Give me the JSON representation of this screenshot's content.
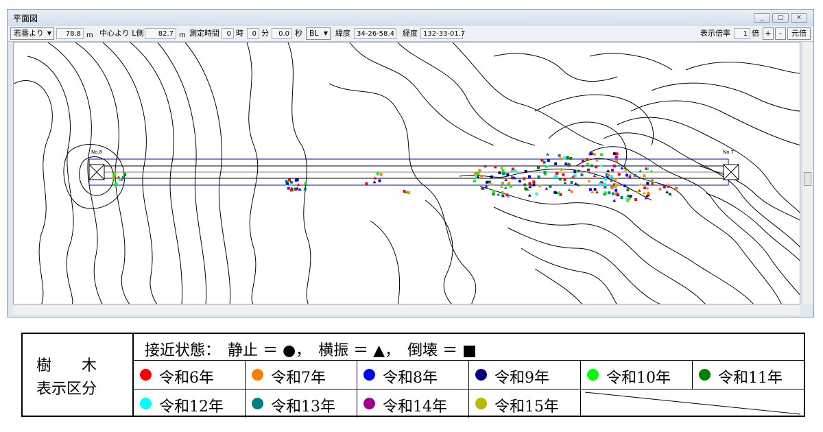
{
  "window": {
    "title": "平面図"
  },
  "toolbar": {
    "from_select": "若番より",
    "distance_value": "78.8",
    "unit_m": "m",
    "center_label": "中心より L側",
    "offset_value": "82.7",
    "measure_time_label": "測定時間",
    "hours": "0",
    "hours_unit": "時",
    "minutes": "0",
    "minutes_unit": "分",
    "seconds": "0.0",
    "seconds_unit": "秒",
    "bl_select": "BL",
    "lat_label": "緯度",
    "lat_value": "34-26-58.4",
    "lon_label": "経度",
    "lon_value": "132-33-01.7",
    "zoom_label": "表示倍率",
    "zoom_value": "1",
    "zoom_unit": "倍",
    "zoom_in": "+",
    "zoom_out": "-",
    "reset": "元倍"
  },
  "map": {
    "left_tower_label": "No.8",
    "right_tower_label": "No.7"
  },
  "legend": {
    "title_line1": "樹　　木",
    "title_line2": "表示区分",
    "status_text": "接近状態：　静止 ＝ ●，　横振 ＝ ▲，　倒壊 ＝ ■",
    "years": [
      {
        "label": "令和6年",
        "color": "#ff0000"
      },
      {
        "label": "令和7年",
        "color": "#ff8000"
      },
      {
        "label": "令和8年",
        "color": "#0000ff"
      },
      {
        "label": "令和9年",
        "color": "#000080"
      },
      {
        "label": "令和10年",
        "color": "#00ff00"
      },
      {
        "label": "令和11年",
        "color": "#008000"
      },
      {
        "label": "令和12年",
        "color": "#00ffff"
      },
      {
        "label": "令和13年",
        "color": "#008080"
      },
      {
        "label": "令和14年",
        "color": "#a0008f"
      },
      {
        "label": "令和15年",
        "color": "#b8b800"
      }
    ]
  }
}
